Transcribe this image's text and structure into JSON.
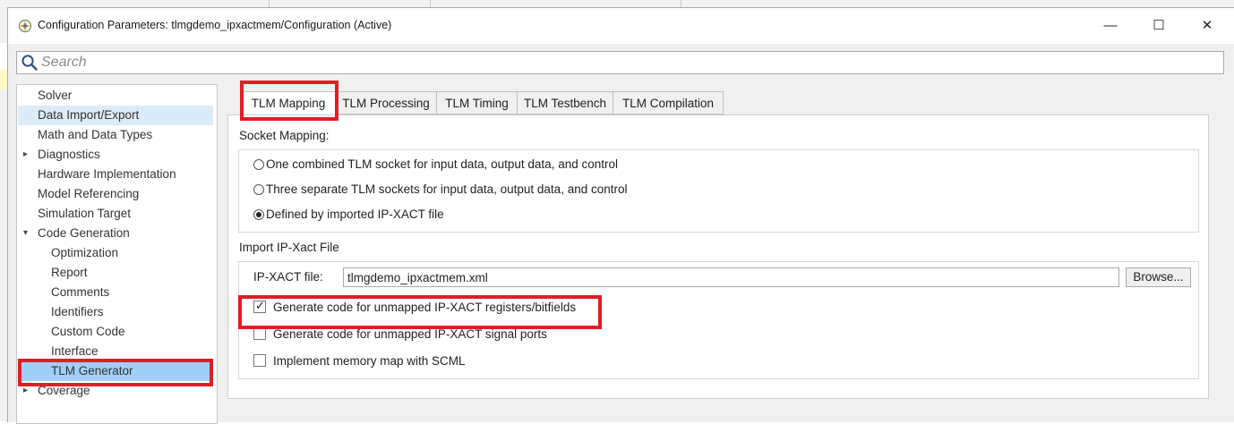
{
  "window": {
    "title": "Configuration Parameters: tlmgdemo_ipxactmem/Configuration (Active)",
    "minimize_glyph": "—",
    "maximize_glyph": "☐",
    "close_glyph": "✕"
  },
  "search": {
    "placeholder": "Search"
  },
  "tree": {
    "items": [
      {
        "label": "Solver"
      },
      {
        "label": "Data Import/Export"
      },
      {
        "label": "Math and Data Types"
      },
      {
        "label": "Diagnostics",
        "expander": "▸"
      },
      {
        "label": "Hardware Implementation"
      },
      {
        "label": "Model Referencing"
      },
      {
        "label": "Simulation Target"
      },
      {
        "label": "Code Generation",
        "expander": "▾"
      },
      {
        "label": "Optimization"
      },
      {
        "label": "Report"
      },
      {
        "label": "Comments"
      },
      {
        "label": "Identifiers"
      },
      {
        "label": "Custom Code"
      },
      {
        "label": "Interface"
      },
      {
        "label": "TLM Generator"
      },
      {
        "label": "Coverage",
        "expander": "▸"
      }
    ],
    "selected": "TLM Generator"
  },
  "tabs": [
    {
      "label": "TLM Mapping",
      "active": true
    },
    {
      "label": "TLM Processing"
    },
    {
      "label": "TLM Timing"
    },
    {
      "label": "TLM Testbench"
    },
    {
      "label": "TLM Compilation"
    }
  ],
  "socket_mapping": {
    "heading": "Socket Mapping:",
    "options": [
      {
        "label": "One combined TLM socket for input data, output data, and control",
        "selected": false
      },
      {
        "label": "Three separate TLM sockets for input data, output data, and control",
        "selected": false
      },
      {
        "label": "Defined by imported IP-XACT file",
        "selected": true
      }
    ]
  },
  "import_ipxact": {
    "heading": "Import IP-Xact File",
    "file_label": "IP-XACT file:",
    "file_value": "tlmgdemo_ipxactmem.xml",
    "browse_label": "Browse...",
    "checkboxes": [
      {
        "label": "Generate code for unmapped IP-XACT registers/bitfields",
        "checked": true
      },
      {
        "label": "Generate code for unmapped IP-XACT signal ports",
        "checked": false
      },
      {
        "label": "Implement memory map with SCML",
        "checked": false
      }
    ]
  },
  "colors": {
    "highlight_outline": "#e01e26",
    "tree_selected": "#9ed0f7",
    "tree_hover": "#dcebf8"
  }
}
